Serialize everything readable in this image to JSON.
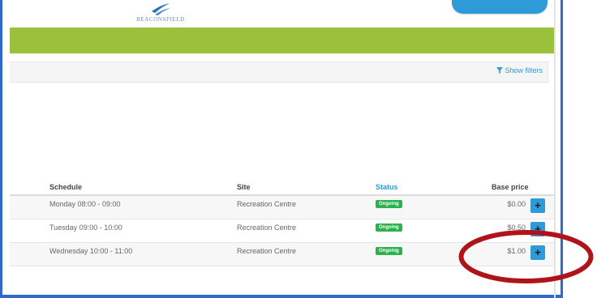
{
  "header": {
    "brand_name": "BEACONSFIELD",
    "brand_color": "#2e6fb6",
    "accent_green": "#9bc13c",
    "accent_blue": "#2e9ad6"
  },
  "filters": {
    "icon": "funnel-icon",
    "label": "Show filters"
  },
  "table": {
    "columns": {
      "schedule": "Schedule",
      "site": "Site",
      "status": "Status",
      "base_price": "Base price"
    },
    "rows": [
      {
        "schedule": "Monday 08:00 - 09:00",
        "site": "Recreation Centre",
        "status": "Ongoing",
        "price": "$0.00",
        "action": "+"
      },
      {
        "schedule": "Tuesday 09:00 - 10:00",
        "site": "Recreation Centre",
        "status": "Ongoing",
        "price": "$0.50",
        "action": "+"
      },
      {
        "schedule": "Wednesday 10:00 - 11:00",
        "site": "Recreation Centre",
        "status": "Ongoing",
        "price": "$1.00",
        "action": "+"
      }
    ]
  },
  "annotation": {
    "color": "#b0141b"
  }
}
